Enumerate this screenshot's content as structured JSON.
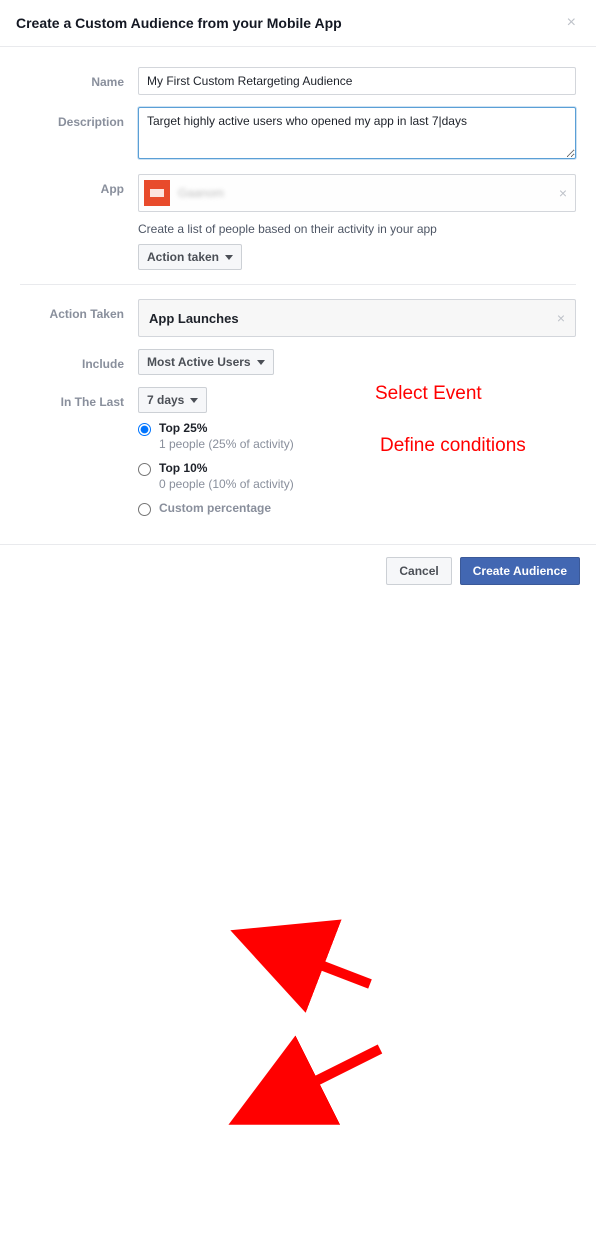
{
  "header": {
    "title": "Create a Custom Audience from your Mobile App"
  },
  "form": {
    "name_label": "Name",
    "name_value": "My First Custom Retargeting Audience",
    "desc_label": "Description",
    "desc_value": "Target highly active users who opened my app in last 7|days",
    "app_label": "App",
    "app_name": "Gaanom",
    "helper": "Create a list of people based on their activity in your app",
    "action_dropdown": "Action taken",
    "action_taken_label": "Action Taken",
    "action_taken_value": "App Launches",
    "include_label": "Include",
    "include_value": "Most Active Users",
    "in_last_label": "In The Last",
    "in_last_value": "7 days",
    "radios": [
      {
        "title": "Top 25%",
        "sub": "1 people (25% of activity)"
      },
      {
        "title": "Top 10%",
        "sub": "0 people (10% of activity)"
      },
      {
        "title": "Custom percentage",
        "sub": ""
      }
    ]
  },
  "footer": {
    "cancel": "Cancel",
    "create": "Create Audience"
  },
  "annotations": {
    "select_event": "Select Event",
    "define_conditions": "Define conditions"
  }
}
